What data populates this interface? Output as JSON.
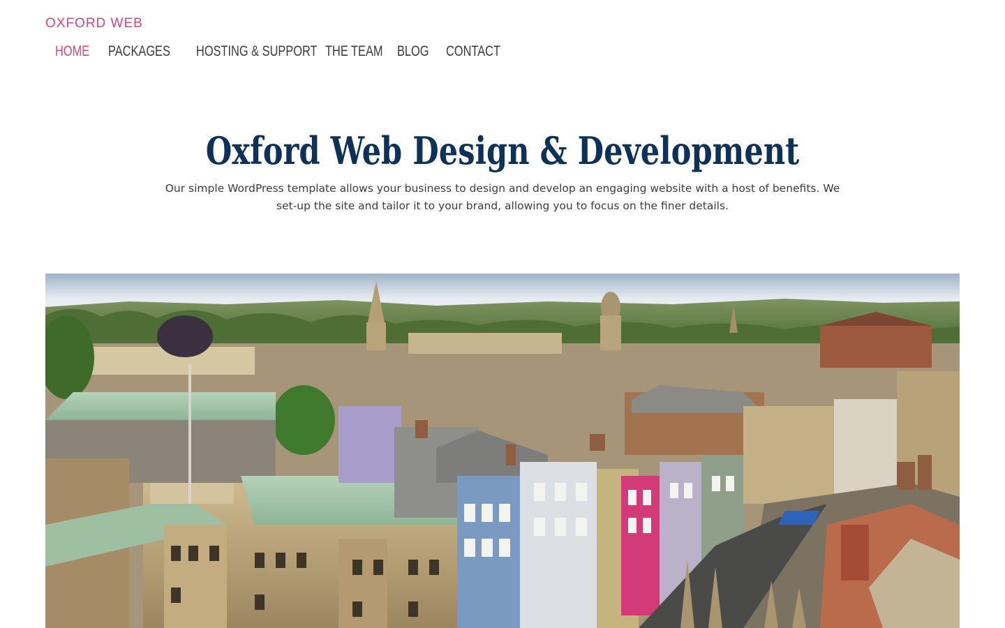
{
  "site": {
    "logo": "OXFORD WEB",
    "brand_color": "#d6457f"
  },
  "nav": {
    "items": [
      {
        "label": "HOME",
        "active": true
      },
      {
        "label": "PACKAGES",
        "active": false
      },
      {
        "label": "HOSTING & SUPPORT",
        "active": false
      },
      {
        "label": "THE TEAM",
        "active": false
      },
      {
        "label": "BLOG",
        "active": false
      },
      {
        "label": "CONTACT",
        "active": false
      }
    ]
  },
  "hero": {
    "title": "Oxford Web Design & Development",
    "title_color": "#0d3159",
    "text": "Our simple WordPress template allows your business to design and develop an engaging website with a host of benefits. We set-up the site and tailor it to your brand, allowing you to focus on the finer details.",
    "image_subject": "aerial view of Oxford city rooftops"
  }
}
